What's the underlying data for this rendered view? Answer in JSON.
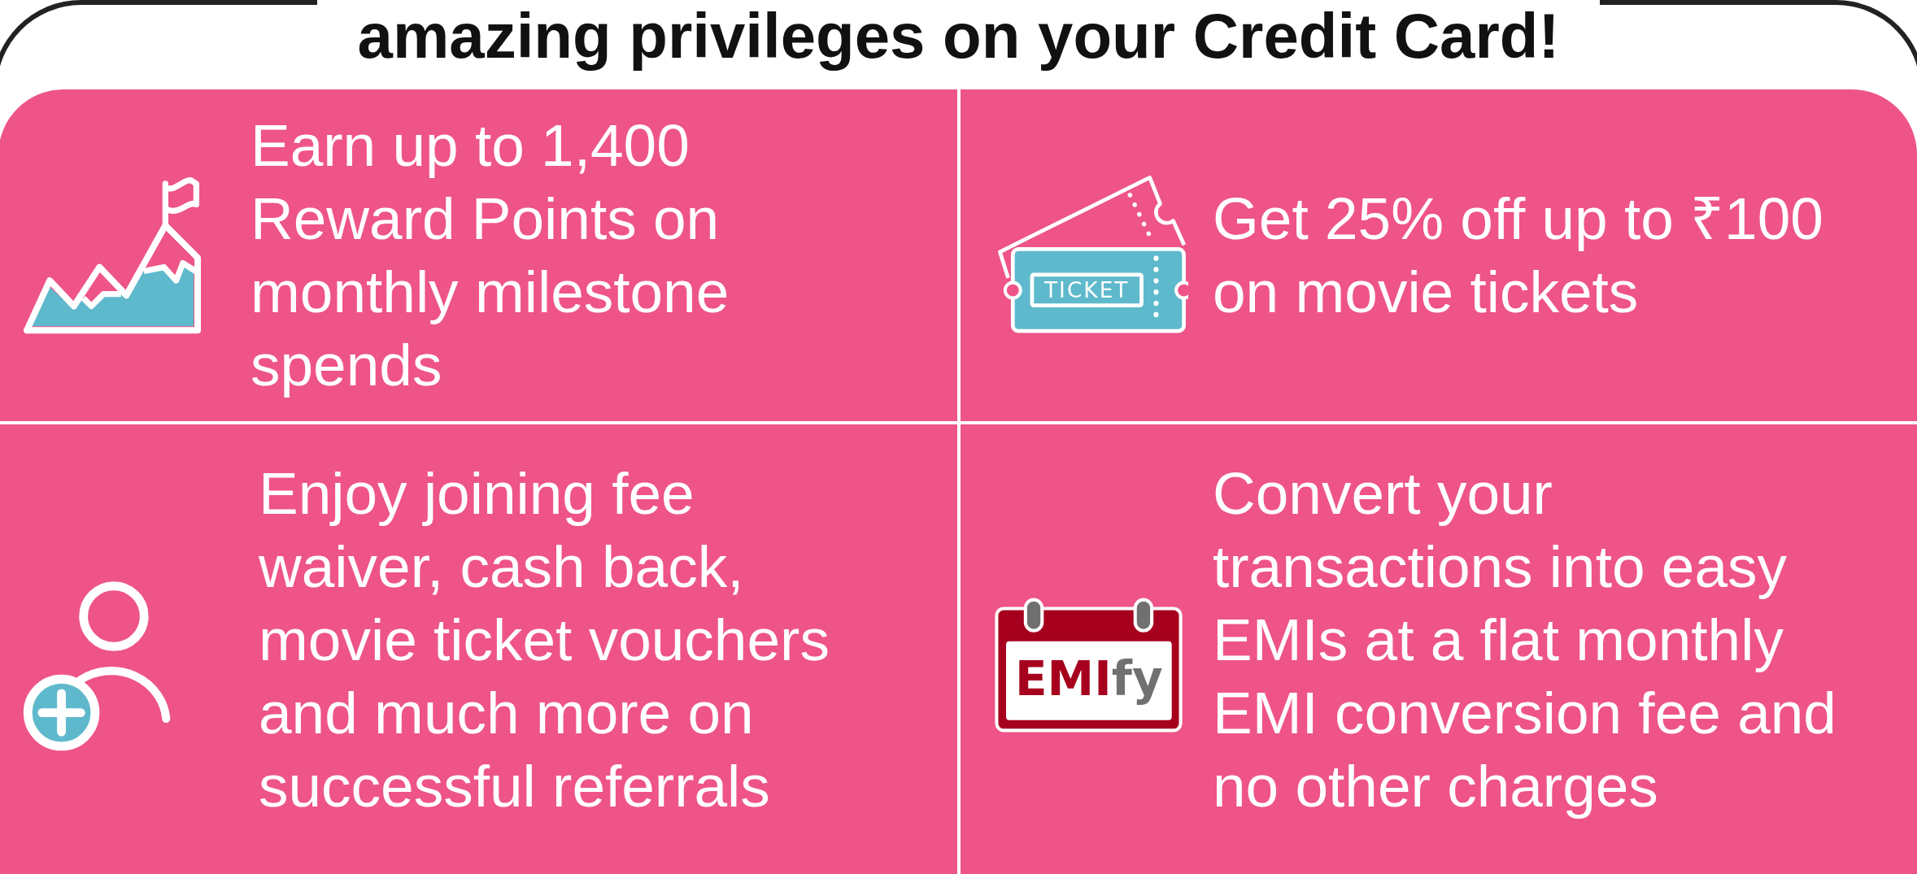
{
  "heading": "amazing privileges on your Credit Card!",
  "benefits": [
    {
      "kind": "milestone",
      "text": "Earn up to 1,400 Reward Points on monthly milestone spends"
    },
    {
      "kind": "ticket",
      "icon_label": "TICKET",
      "text": "Get 25% off up to ₹100 on movie tickets"
    },
    {
      "kind": "referral",
      "text": "Enjoy joining fee waiver, cash back, movie ticket vouchers and much more on successful referrals"
    },
    {
      "kind": "emi",
      "icon_label_strong": "EMI",
      "icon_label_light": "fy",
      "text": "Convert your transactions into easy EMIs at a flat monthly EMI conversion fee and no other charges"
    }
  ]
}
